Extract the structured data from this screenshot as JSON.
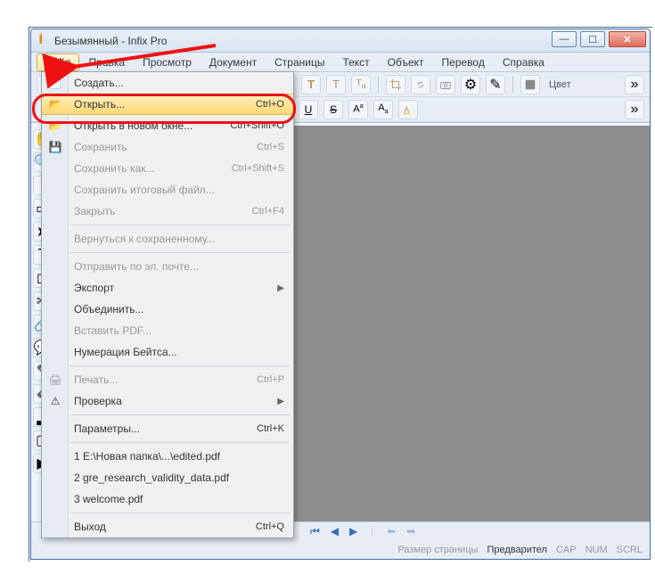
{
  "window": {
    "title": "Безымянный - Infix Pro"
  },
  "menubar": {
    "items": [
      {
        "label": "Файл",
        "active": true
      },
      {
        "label": "Правка"
      },
      {
        "label": "Просмотр"
      },
      {
        "label": "Документ"
      },
      {
        "label": "Страницы"
      },
      {
        "label": "Текст"
      },
      {
        "label": "Объект"
      },
      {
        "label": "Перевод"
      },
      {
        "label": "Справка"
      }
    ]
  },
  "toolbar": {
    "color_label": "Цвет"
  },
  "dropdown": {
    "create": "Создать...",
    "open": "Открыть...",
    "open_sc": "Ctrl+O",
    "open_new": "Открыть в новом окне...",
    "open_new_sc": "Ctrl+Shift+O",
    "save": "Сохранить",
    "save_sc": "Ctrl+S",
    "save_as": "Сохранить как...",
    "save_as_sc": "Ctrl+Shift+S",
    "save_final": "Сохранить итоговый файл...",
    "close": "Закрыть",
    "close_sc": "Ctrl+F4",
    "revert": "Вернуться к сохраненному...",
    "send_mail": "Отправить по эл. почте...",
    "export": "Экспорт",
    "merge": "Объединить...",
    "insert_pdf": "Вставить PDF...",
    "bates": "Нумерация Бейтса...",
    "print": "Печать...",
    "print_sc": "Ctrl+P",
    "check": "Проверка",
    "params": "Параметры...",
    "params_sc": "Ctrl+K",
    "recent1": "1 E:\\Новая папка\\...\\edited.pdf",
    "recent2": "2 gre_research_validity_data.pdf",
    "recent3": "3 welcome.pdf",
    "exit": "Выход",
    "exit_sc": "Ctrl+Q"
  },
  "status": {
    "page_size": "Размер страницы",
    "preview": "Предварител",
    "cap": "CAP",
    "num": "NUM",
    "scrl": "SCRL"
  }
}
